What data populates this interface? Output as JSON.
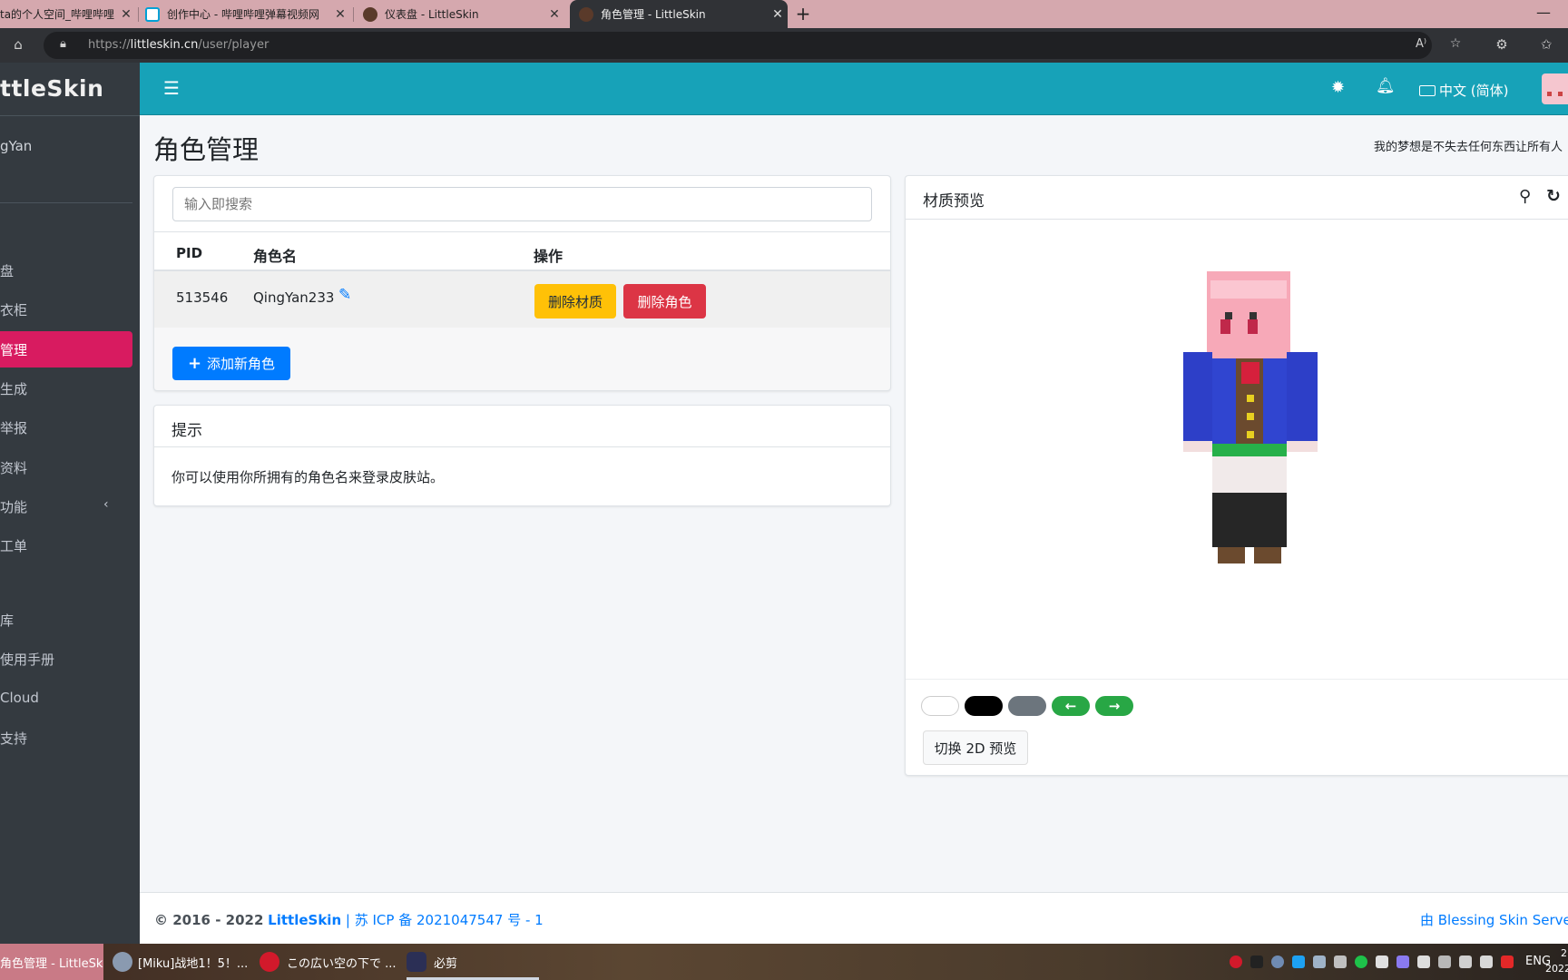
{
  "browser": {
    "tabs": [
      {
        "title": "ta的个人空间_哔哩哔哩"
      },
      {
        "title": "创作中心 - 哔哩哔哩弹幕视频网"
      },
      {
        "title": "仪表盘 - LittleSkin"
      },
      {
        "title": "角色管理 - LittleSkin"
      }
    ],
    "url_prefix": "https://",
    "url_domain": "littleskin.cn",
    "url_path": "/user/player",
    "read_aloud": "A⁾"
  },
  "sidebar": {
    "brand": "ttleSkin",
    "user": "gYan",
    "items": [
      {
        "label": "盘"
      },
      {
        "label": "衣柜"
      },
      {
        "label": "管理"
      },
      {
        "label": "生成"
      },
      {
        "label": "举报"
      },
      {
        "label": "资料"
      },
      {
        "label": "功能"
      },
      {
        "label": "工单"
      },
      {
        "label": "库"
      },
      {
        "label": "使用手册"
      },
      {
        "label": "Cloud"
      },
      {
        "label": "支持"
      }
    ]
  },
  "navbar": {
    "language": "中文 (简体)"
  },
  "page": {
    "title": "角色管理",
    "motto": "我的梦想是不失去任何东西让所有人"
  },
  "players": {
    "search_placeholder": "输入即搜索",
    "columns": {
      "pid": "PID",
      "name": "角色名",
      "actions": "操作"
    },
    "rows": [
      {
        "pid": "513546",
        "name": "QingYan233",
        "delete_texture": "删除材质",
        "delete_player": "删除角色"
      }
    ],
    "add_button": "添加新角色"
  },
  "tip": {
    "title": "提示",
    "body": "你可以使用你所拥有的角色名来登录皮肤站。"
  },
  "preview": {
    "title": "材质预览",
    "switch_2d": "切换 2D 预览"
  },
  "footer": {
    "copyright": "© 2016 - 2022",
    "site": "LittleSkin",
    "icp": "| 苏 ICP 备 2021047547 号 - 1",
    "powered_by": "由 Blessing Skin Server"
  },
  "taskbar": {
    "items": [
      {
        "label": "角色管理 - LittleSk..."
      },
      {
        "label": "[Miku]战地1！5！..."
      },
      {
        "label": "この広い空の下で ..."
      },
      {
        "label": "必剪"
      }
    ],
    "lang": "ENG",
    "clock_time": "2",
    "clock_date": "2022"
  },
  "colors": {
    "navbar": "#17a2b8",
    "sidebar": "#343a40",
    "active_item": "#d81b60",
    "warning": "#ffc107",
    "danger": "#dc3545",
    "primary": "#007bff",
    "success": "#28a745",
    "secondary": "#6c757d"
  }
}
